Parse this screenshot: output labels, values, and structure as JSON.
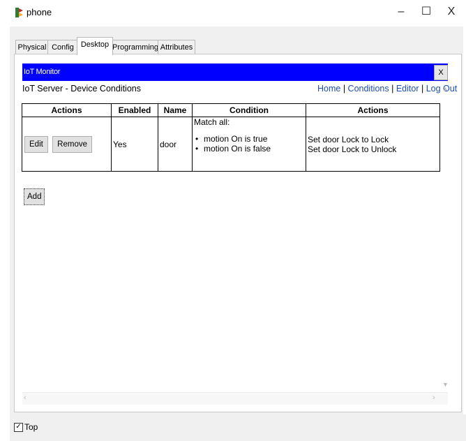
{
  "window": {
    "title": "phone",
    "minimize": "–",
    "maximize": "☐",
    "close": "X"
  },
  "tabs": [
    {
      "label": "Physical",
      "active": false
    },
    {
      "label": "Config",
      "active": false
    },
    {
      "label": "Desktop",
      "active": true
    },
    {
      "label": "Programming",
      "active": false
    },
    {
      "label": "Attributes",
      "active": false
    }
  ],
  "iot": {
    "header_title": "IoT Monitor",
    "close_label": "X",
    "server_title": "IoT Server - Device Conditions",
    "nav": {
      "home": "Home",
      "sep": " | ",
      "conditions": "Conditions",
      "editor": "Editor",
      "logout": "Log Out"
    }
  },
  "table": {
    "headers": [
      "Actions",
      "Enabled",
      "Name",
      "Condition",
      "Actions"
    ],
    "rows": [
      {
        "edit": "Edit",
        "remove": "Remove",
        "enabled": "Yes",
        "name": "door",
        "match": "Match all:",
        "conditions": [
          "motion On is true",
          "motion On is false"
        ],
        "actions": [
          "Set door Lock to Lock",
          "Set door Lock to Unlock"
        ]
      }
    ]
  },
  "add_label": "Add",
  "footer": {
    "top_label": "Top",
    "top_checked": true
  },
  "icons": {
    "app": "packet-tracer-icon",
    "scroll_up": "chevron-up-icon",
    "scroll_down": "chevron-down-icon",
    "scroll_left": "chevron-left-icon",
    "scroll_right": "chevron-right-icon"
  }
}
